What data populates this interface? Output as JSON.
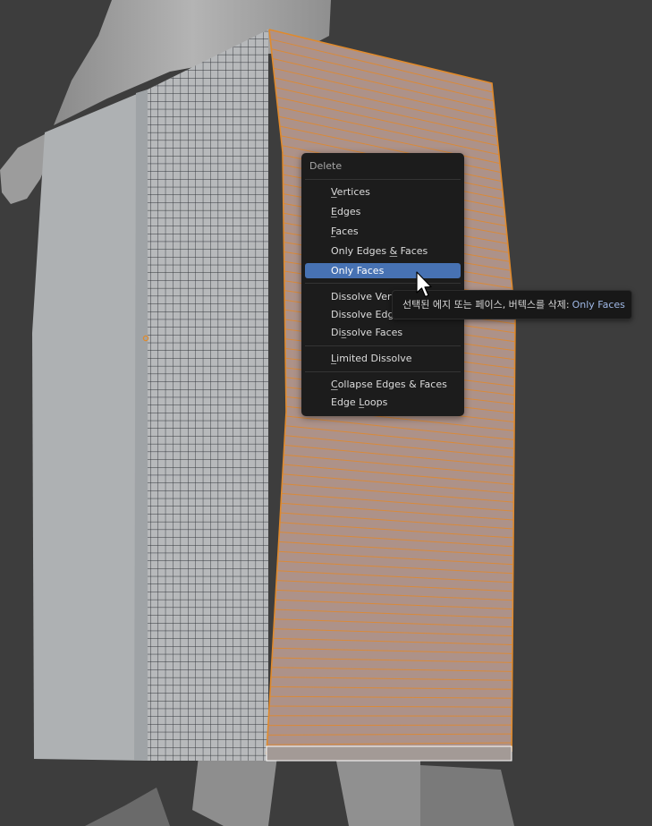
{
  "menu": {
    "title": "Delete",
    "groups": [
      [
        {
          "label": "Vertices",
          "key": "V",
          "rest": "ertices"
        },
        {
          "label": "Edges",
          "key": "E",
          "rest": "dges"
        },
        {
          "label": "Faces",
          "key": "F",
          "rest": "aces"
        },
        {
          "label": "Only Edges & Faces",
          "pre": "Only Edges ",
          "key": "&",
          "rest": " Faces"
        },
        {
          "label": "Only Faces",
          "pre": "",
          "key": "",
          "rest": "Only Faces",
          "active": true
        }
      ],
      [
        {
          "label": "Dissolve Vertices",
          "visible": "Dissolve Vert"
        },
        {
          "label": "Dissolve Edges",
          "visible": "Dissolve Edge"
        },
        {
          "label": "Dissolve Faces",
          "pre": "Di",
          "key": "s",
          "rest": "solve Faces"
        }
      ],
      [
        {
          "label": "Limited Dissolve",
          "key": "L",
          "rest": "imited Dissolve"
        }
      ],
      [
        {
          "label": "Collapse Edges & Faces",
          "key": "C",
          "rest": "ollapse Edges & Faces"
        },
        {
          "label": "Edge Loops",
          "pre": "Edge ",
          "key": "L",
          "rest": "oops"
        }
      ]
    ]
  },
  "tooltip": {
    "text": "선택된 에지 또는 페이스, 버텍스를 삭제:",
    "operator": "Only Faces"
  },
  "colors": {
    "viewport_bg": "#3d3d3d",
    "selection": "#e08a2c",
    "menu_bg": "#1c1c1c",
    "menu_highlight": "#4772b3"
  }
}
